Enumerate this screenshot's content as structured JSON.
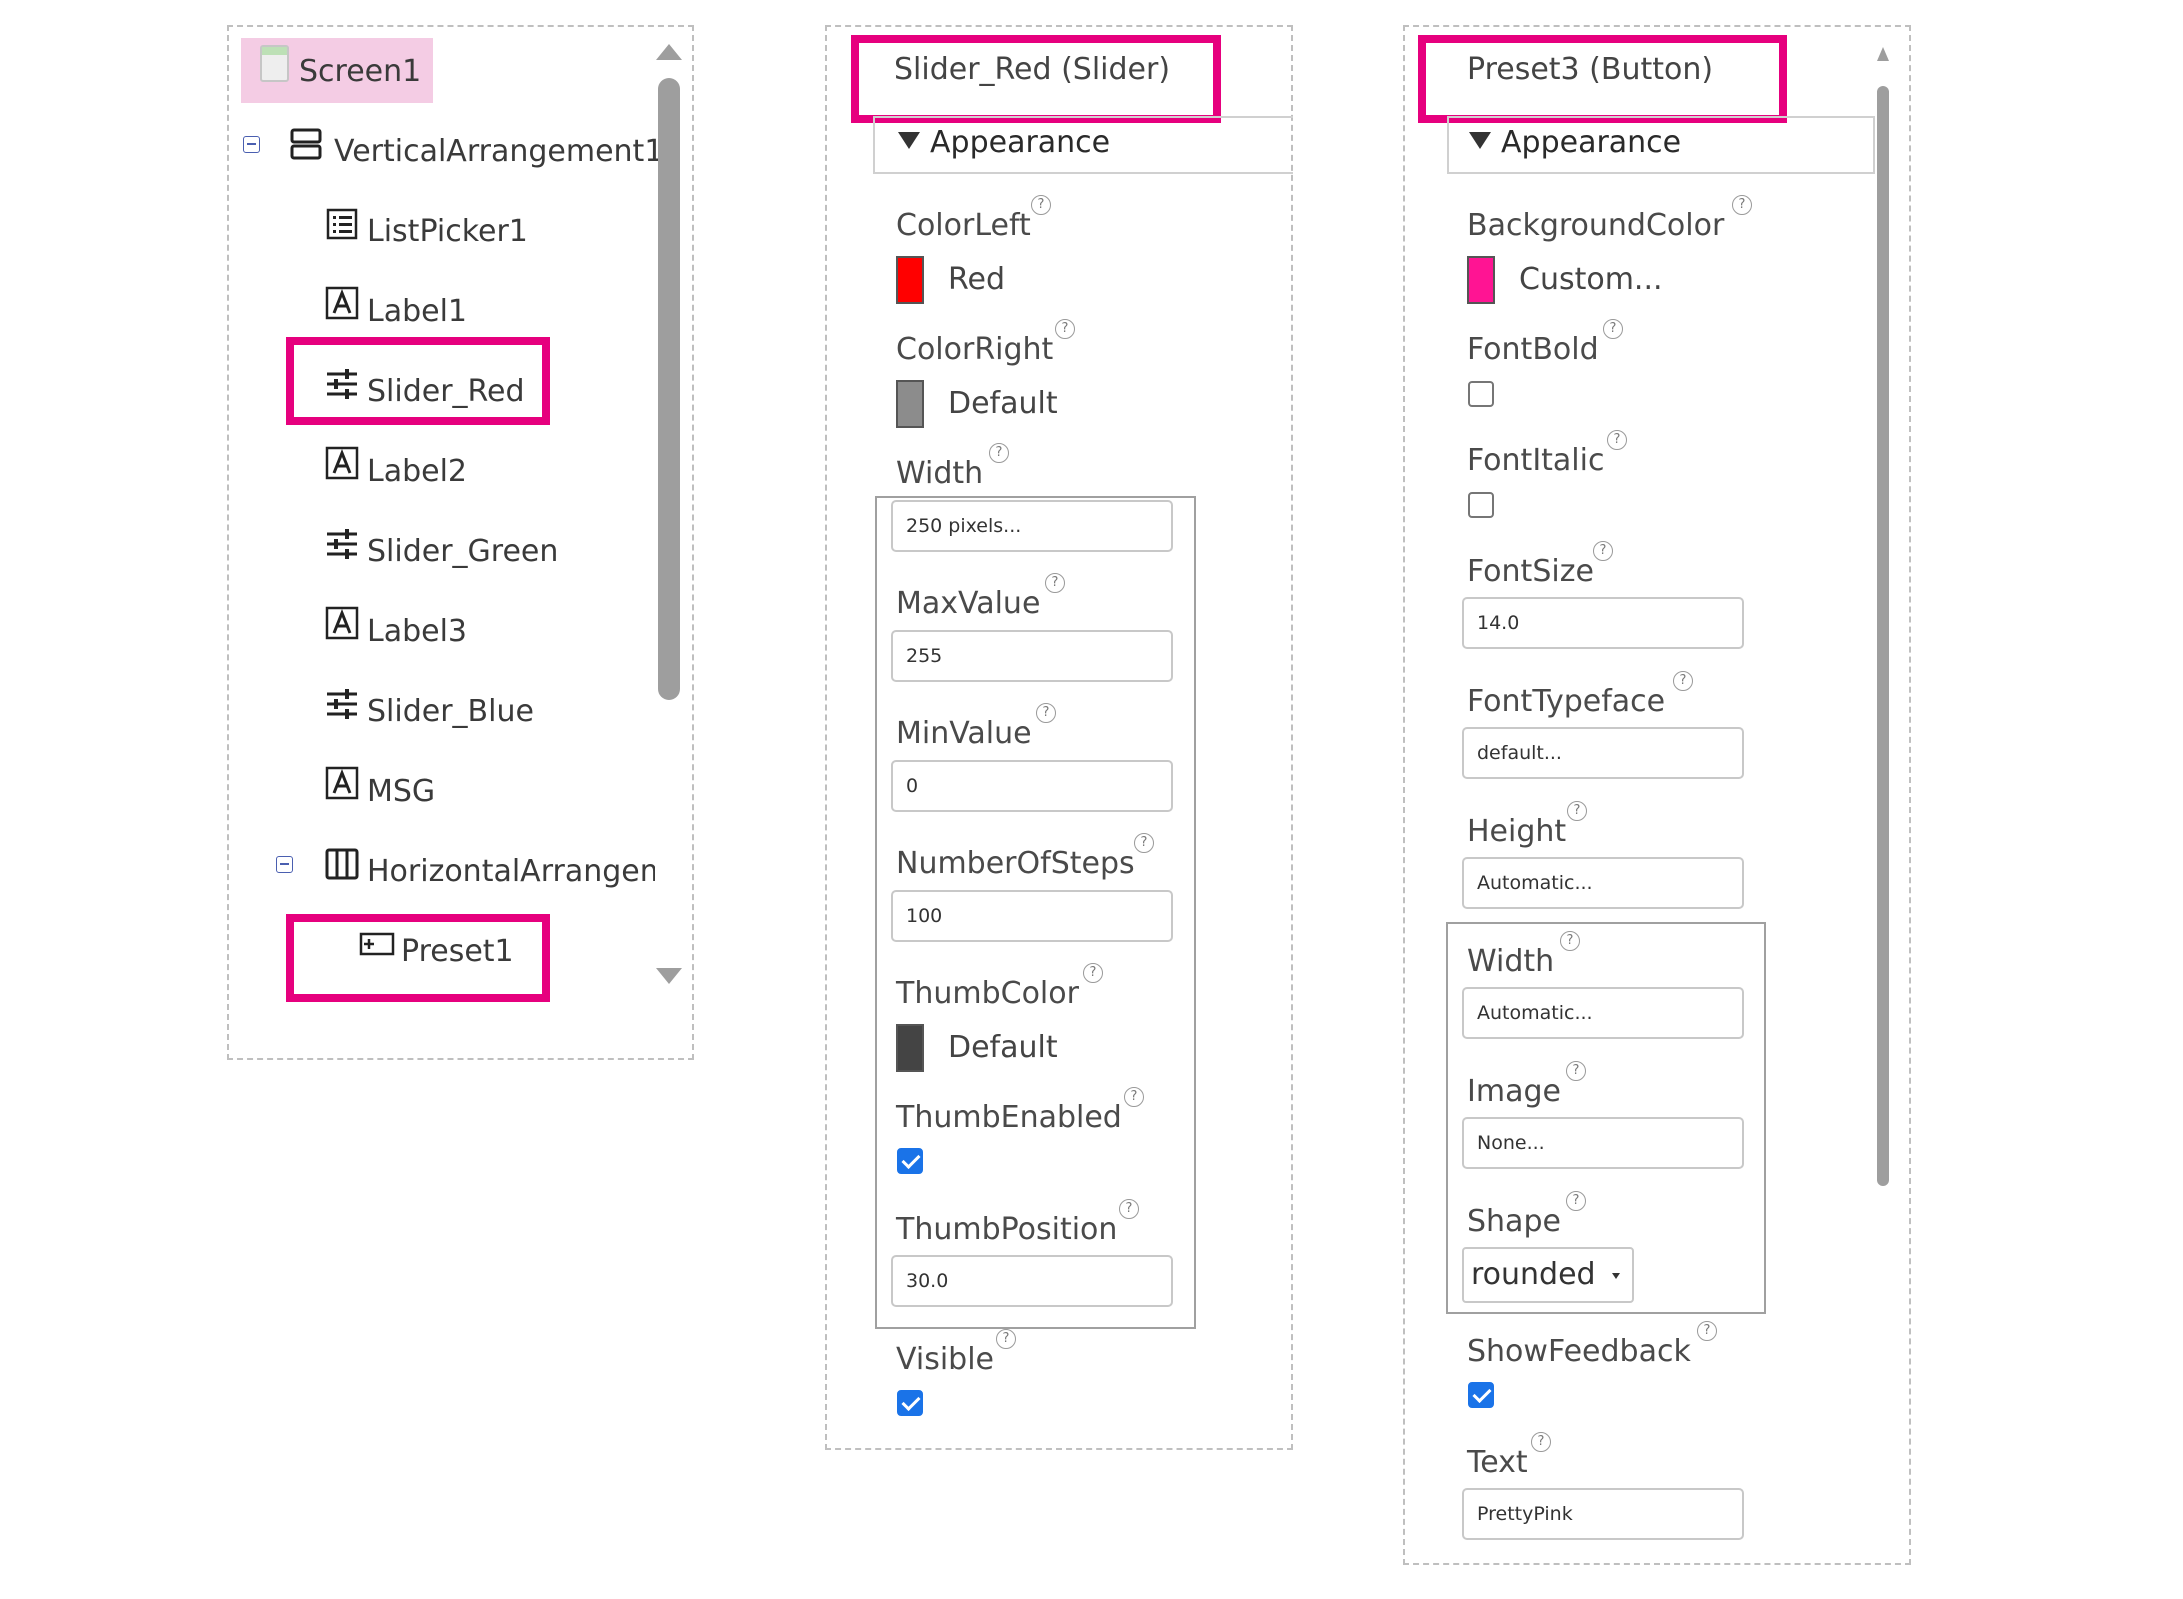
{
  "tree": {
    "items": [
      {
        "label": "Screen1",
        "icon": "screen-icon"
      },
      {
        "label": "VerticalArrangement1",
        "icon": "vertical-arrangement-icon"
      },
      {
        "label": "ListPicker1",
        "icon": "listpicker-icon"
      },
      {
        "label": "Label1",
        "icon": "label-icon"
      },
      {
        "label": "Slider_Red",
        "icon": "slider-icon"
      },
      {
        "label": "Label2",
        "icon": "label-icon"
      },
      {
        "label": "Slider_Green",
        "icon": "slider-icon"
      },
      {
        "label": "Label3",
        "icon": "label-icon"
      },
      {
        "label": "Slider_Blue",
        "icon": "slider-icon"
      },
      {
        "label": "MSG",
        "icon": "label-icon"
      },
      {
        "label": "HorizontalArrangem",
        "icon": "horizontal-arrangement-icon"
      },
      {
        "label": "Preset1",
        "icon": "button-icon"
      }
    ]
  },
  "slider_panel": {
    "title": "Slider_Red (Slider)",
    "section": "Appearance",
    "color_left": {
      "label": "ColorLeft",
      "value": "Red",
      "color": "#ff0000"
    },
    "color_right": {
      "label": "ColorRight",
      "value": "Default",
      "color": "#8c8c8c"
    },
    "width": {
      "label": "Width",
      "value": "250 pixels..."
    },
    "max_value": {
      "label": "MaxValue",
      "value": "255"
    },
    "min_value": {
      "label": "MinValue",
      "value": "0"
    },
    "number_of_steps": {
      "label": "NumberOfSteps",
      "value": "100"
    },
    "thumb_color": {
      "label": "ThumbColor",
      "value": "Default",
      "color": "#444444"
    },
    "thumb_enabled": {
      "label": "ThumbEnabled",
      "checked": true
    },
    "thumb_position": {
      "label": "ThumbPosition",
      "value": "30.0"
    },
    "visible": {
      "label": "Visible",
      "checked": true
    }
  },
  "button_panel": {
    "title": "Preset3 (Button)",
    "section": "Appearance",
    "background_color": {
      "label": "BackgroundColor",
      "value": "Custom...",
      "color": "#ff1493"
    },
    "font_bold": {
      "label": "FontBold",
      "checked": false
    },
    "font_italic": {
      "label": "FontItalic",
      "checked": false
    },
    "font_size": {
      "label": "FontSize",
      "value": "14.0"
    },
    "font_typeface": {
      "label": "FontTypeface",
      "value": "default..."
    },
    "height": {
      "label": "Height",
      "value": "Automatic..."
    },
    "width": {
      "label": "Width",
      "value": "Automatic..."
    },
    "image": {
      "label": "Image",
      "value": "None..."
    },
    "shape": {
      "label": "Shape",
      "value": "rounded"
    },
    "show_feedback": {
      "label": "ShowFeedback",
      "checked": true
    },
    "text": {
      "label": "Text",
      "value": "PrettyPink"
    }
  },
  "help_glyph": "?",
  "highlight_color": "#e6007e"
}
